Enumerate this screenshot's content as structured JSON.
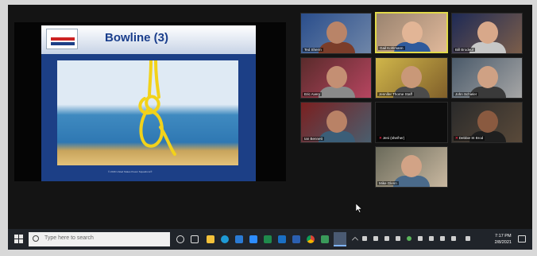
{
  "slide": {
    "title": "Bowline (3)",
    "footer": "© 2016 United States Power Squadrons®"
  },
  "participants": [
    {
      "name": "Ted Sherm",
      "muted": false
    },
    {
      "name": "Gail Kohlmann",
      "muted": false,
      "active": true
    },
    {
      "name": "Bill Brodeur",
      "muted": false
    },
    {
      "name": "Eric Avery",
      "muted": false
    },
    {
      "name": "Jennifer Thorne  Staff",
      "muted": false
    },
    {
      "name": "John Schieler",
      "muted": false
    },
    {
      "name": "Ian Bennett",
      "muted": false
    },
    {
      "name": "Jeni (she/her)",
      "muted": true
    },
    {
      "name": "Debbie St Brod",
      "muted": true
    },
    {
      "name": "Mike Glenn",
      "muted": false
    }
  ],
  "taskbar": {
    "search_placeholder": "Type here to search",
    "time": "7:17 PM",
    "date": "2/8/2021"
  },
  "colors": {
    "slide_blue": "#1c3f86",
    "active_speaker": "#e1d94a",
    "rope": "#f2d21a"
  }
}
